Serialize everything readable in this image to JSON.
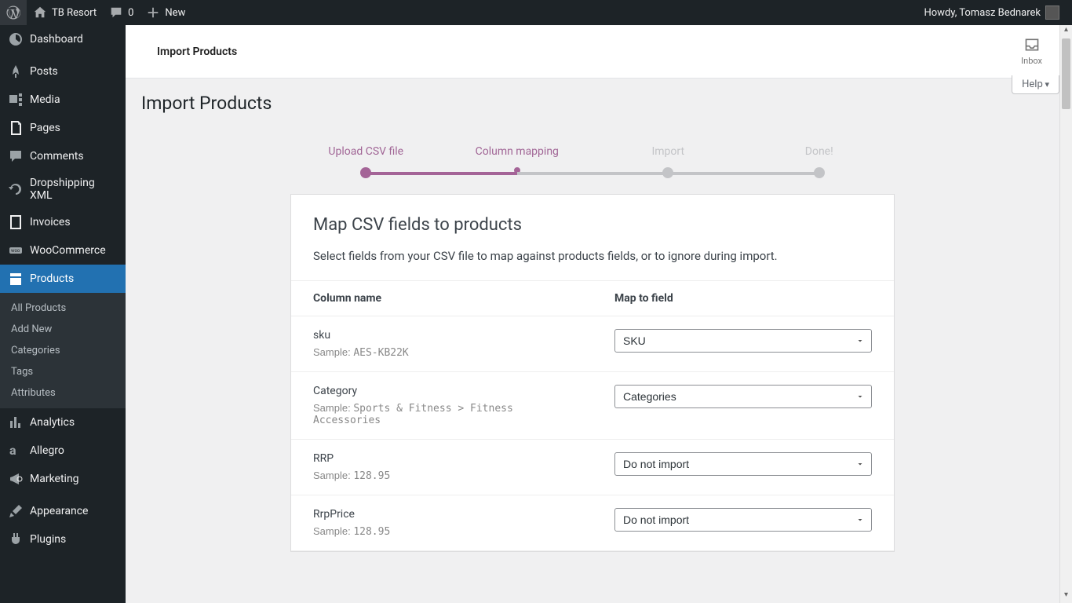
{
  "adminbar": {
    "site_name": "TB Resort",
    "comments_count": "0",
    "new_label": "New",
    "howdy": "Howdy, Tomasz Bednarek"
  },
  "sidebar": {
    "items": [
      {
        "label": "Dashboard",
        "icon": "dashboard"
      },
      {
        "label": "Posts",
        "icon": "pin"
      },
      {
        "label": "Media",
        "icon": "media"
      },
      {
        "label": "Pages",
        "icon": "page"
      },
      {
        "label": "Comments",
        "icon": "comment"
      },
      {
        "label": "Dropshipping XML",
        "icon": "refresh"
      },
      {
        "label": "Invoices",
        "icon": "invoice"
      },
      {
        "label": "WooCommerce",
        "icon": "woo"
      },
      {
        "label": "Products",
        "icon": "products",
        "current": true,
        "submenu": [
          "All Products",
          "Add New",
          "Categories",
          "Tags",
          "Attributes"
        ]
      },
      {
        "label": "Analytics",
        "icon": "chart"
      },
      {
        "label": "Allegro",
        "icon": "allegro"
      },
      {
        "label": "Marketing",
        "icon": "megaphone"
      },
      {
        "label": "Appearance",
        "icon": "brush"
      },
      {
        "label": "Plugins",
        "icon": "plugin"
      }
    ]
  },
  "header": {
    "title": "Import Products",
    "inbox": "Inbox"
  },
  "page": {
    "title": "Import Products",
    "help": "Help",
    "steps": [
      "Upload CSV file",
      "Column mapping",
      "Import",
      "Done!"
    ],
    "step_states": [
      "done",
      "active",
      "",
      ""
    ]
  },
  "card": {
    "title": "Map CSV fields to products",
    "desc": "Select fields from your CSV file to map against products fields, or to ignore during import.",
    "th1": "Column name",
    "th2": "Map to field",
    "sample_label": "Sample:",
    "rows": [
      {
        "name": "sku",
        "sample": "AES-KB22K",
        "field": "SKU"
      },
      {
        "name": "Category",
        "sample": "Sports & Fitness > Fitness Accessories",
        "field": "Categories"
      },
      {
        "name": "RRP",
        "sample": "128.95",
        "field": "Do not import"
      },
      {
        "name": "RrpPrice",
        "sample": "128.95",
        "field": "Do not import"
      }
    ]
  }
}
